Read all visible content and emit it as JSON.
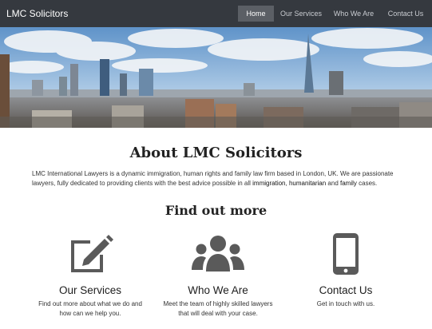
{
  "navbar": {
    "brand": "LMC Solicitors",
    "links": [
      {
        "label": "Home",
        "active": true
      },
      {
        "label": "Our Services",
        "active": false
      },
      {
        "label": "Who We Are",
        "active": false
      },
      {
        "label": "Contact Us",
        "active": false
      }
    ]
  },
  "about": {
    "title": "About LMC Solicitors",
    "text_part1": "LMC International Lawyers is a dynamic immigration, human rights and family law firm based in London, UK. We are passionate lawyers, fully dedicated to providing clients with the best advice possible in all ",
    "keyword1": "immigration",
    "sep1": ", ",
    "keyword2": "humanitarian",
    "sep2": " and ",
    "keyword3": "family",
    "text_end": " cases."
  },
  "find_out_more": {
    "title": "Find out more",
    "features": [
      {
        "icon": "edit-icon",
        "title": "Our Services",
        "desc_line1": "Find out more about what we do and",
        "desc_line2": "how can we help you."
      },
      {
        "icon": "users-icon",
        "title": "Who We Are",
        "desc_line1": "Meet the team of highly skilled lawyers",
        "desc_line2": "that will deal with your case."
      },
      {
        "icon": "mobile-icon",
        "title": "Contact Us",
        "desc_line1": "Get in touch with us.",
        "desc_line2": ""
      }
    ]
  },
  "colors": {
    "navbar_bg": "#35393f",
    "nav_active_bg": "#5b5f65",
    "icon_gray": "#5a5a5a"
  }
}
